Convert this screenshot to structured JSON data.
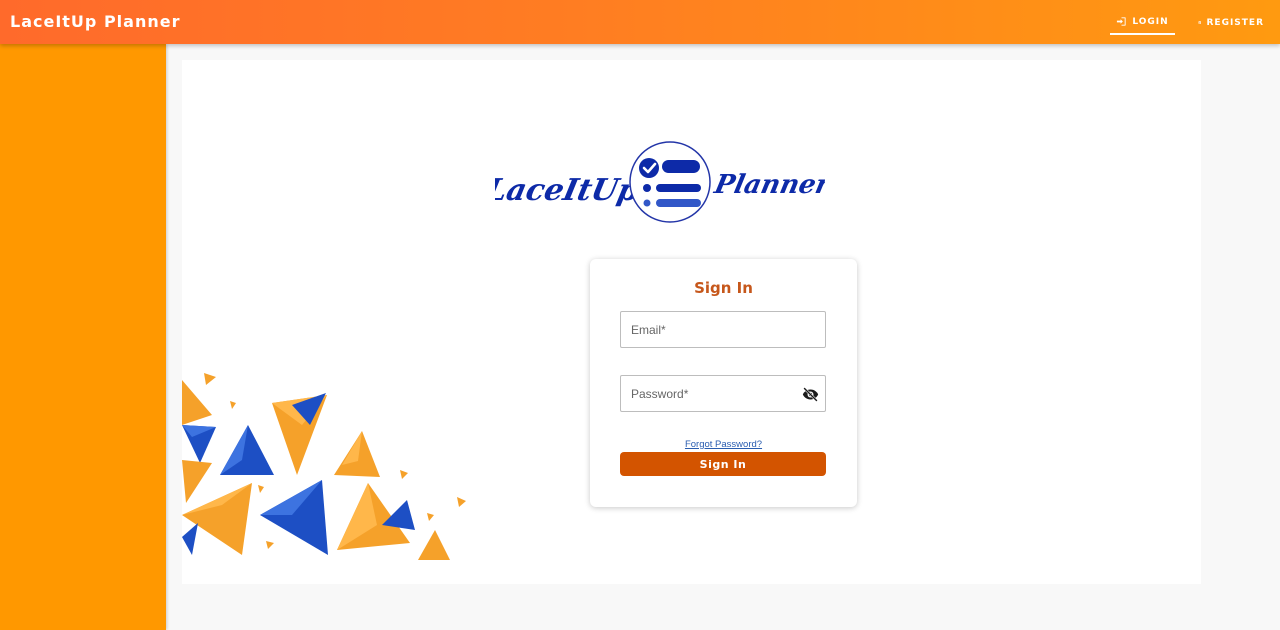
{
  "header": {
    "title": "LaceItUp Planner",
    "nav": [
      {
        "label": "LOGIN",
        "icon": "login-icon",
        "active": true
      },
      {
        "label": "REGISTER",
        "icon": "register-icon",
        "active": false
      }
    ]
  },
  "logo": {
    "left_text": "LaceItUp",
    "right_text": "Planner",
    "icon": "checklist-icon"
  },
  "signin": {
    "title": "Sign In",
    "email_placeholder": "Email*",
    "password_placeholder": "Password*",
    "password_toggle_icon": "eye-off-icon",
    "forgot_label": "Forgot Password?",
    "submit_label": "Sign In"
  },
  "colors": {
    "header_gradient_start": "#ff6a2b",
    "header_gradient_end": "#ff9a10",
    "sidebar": "#ff9800",
    "accent_text": "#c6571b",
    "button": "#d35400",
    "logo_blue": "#0d2aa8",
    "decor_orange": "#f5a12a",
    "decor_blue": "#1d4fc4"
  }
}
